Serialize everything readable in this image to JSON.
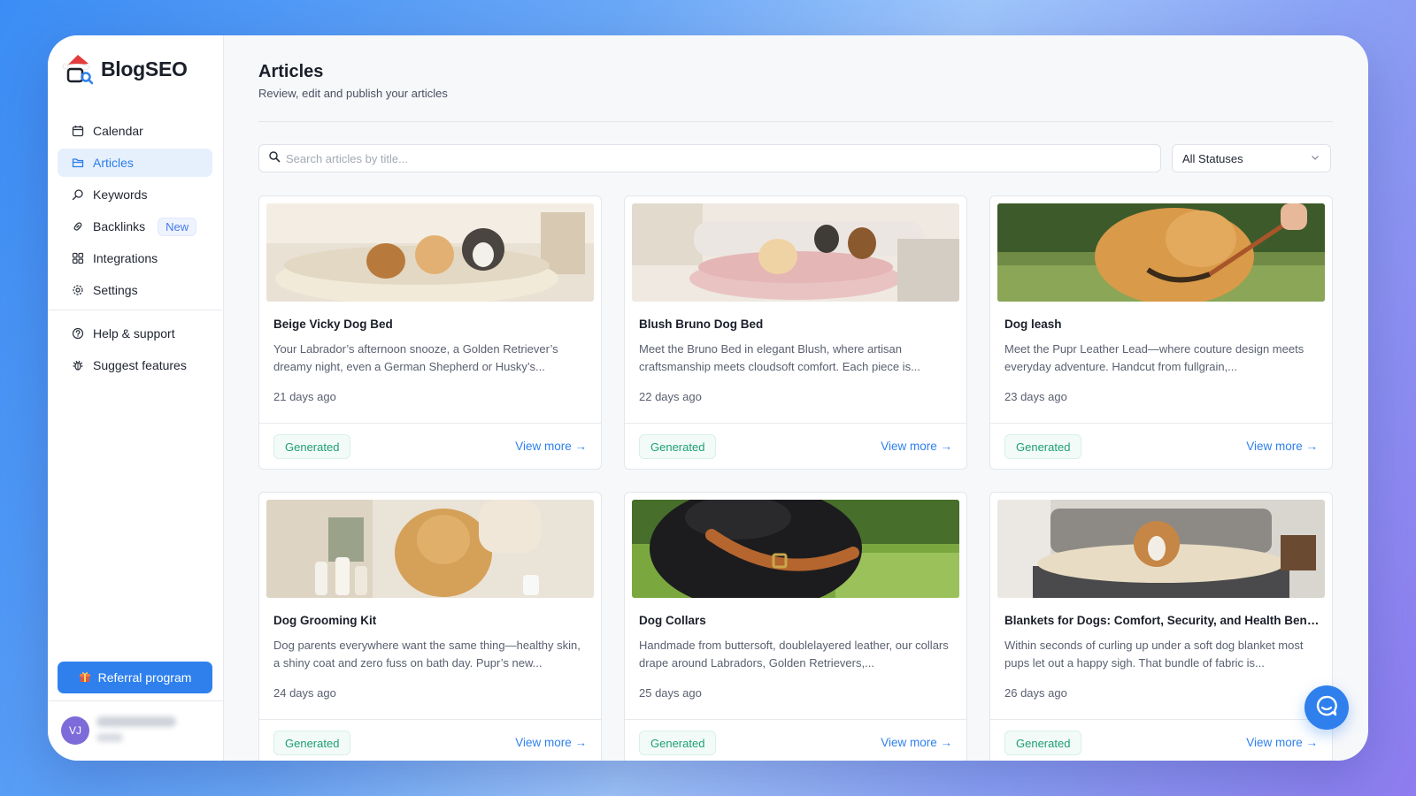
{
  "app": {
    "name": "BlogSEO"
  },
  "sidebar": {
    "items": [
      {
        "label": "Calendar",
        "icon": "calendar-icon",
        "active": false
      },
      {
        "label": "Articles",
        "icon": "folder-icon",
        "active": true
      },
      {
        "label": "Keywords",
        "icon": "search-icon",
        "active": false
      },
      {
        "label": "Backlinks",
        "icon": "link-icon",
        "active": false,
        "badge": "New"
      },
      {
        "label": "Integrations",
        "icon": "grid-icon",
        "active": false
      },
      {
        "label": "Settings",
        "icon": "gear-icon",
        "active": false
      }
    ],
    "secondary": [
      {
        "label": "Help & support",
        "icon": "help-icon"
      },
      {
        "label": "Suggest features",
        "icon": "bug-icon"
      }
    ],
    "referral_label": "Referral program",
    "user": {
      "initials": "VJ"
    }
  },
  "header": {
    "title": "Articles",
    "subtitle": "Review, edit and publish your articles"
  },
  "search": {
    "placeholder": "Search articles by title..."
  },
  "filter": {
    "selected": "All Statuses"
  },
  "cards": [
    {
      "title": "Beige Vicky Dog Bed",
      "desc": "Your Labrador’s afternoon snooze, a Golden Retriever’s dreamy night, even a German Shepherd or Husky’s...",
      "date": "21 days ago",
      "status": "Generated",
      "link": "View more →"
    },
    {
      "title": "Blush Bruno Dog Bed",
      "desc": "Meet the Bruno Bed in elegant Blush, where artisan craftsmanship meets cloudsoft comfort. Each piece is...",
      "date": "22 days ago",
      "status": "Generated",
      "link": "View more →"
    },
    {
      "title": "Dog leash",
      "desc": "Meet the Pupr Leather Lead—where couture design meets everyday adventure. Handcut from fullgrain,...",
      "date": "23 days ago",
      "status": "Generated",
      "link": "View more →"
    },
    {
      "title": "Dog Grooming Kit",
      "desc": "Dog parents everywhere want the same thing—healthy skin, a shiny coat and zero fuss on bath day. Pupr’s new...",
      "date": "24 days ago",
      "status": "Generated",
      "link": "View more →"
    },
    {
      "title": "Dog Collars",
      "desc": "Handmade from buttersoft, doublelayered leather, our collars drape around Labradors, Golden Retrievers,...",
      "date": "25 days ago",
      "status": "Generated",
      "link": "View more →"
    },
    {
      "title": "Blankets for Dogs: Comfort, Security, and Health Bene...",
      "desc": "Within seconds of curling up under a soft dog blanket most pups let out a happy sigh. That bundle of fabric is...",
      "date": "26 days ago",
      "status": "Generated",
      "link": "View more →"
    }
  ],
  "colors": {
    "accent": "#2f80ed",
    "status_generated": "#1f9e76",
    "active_nav_bg": "#e6f0fd"
  }
}
